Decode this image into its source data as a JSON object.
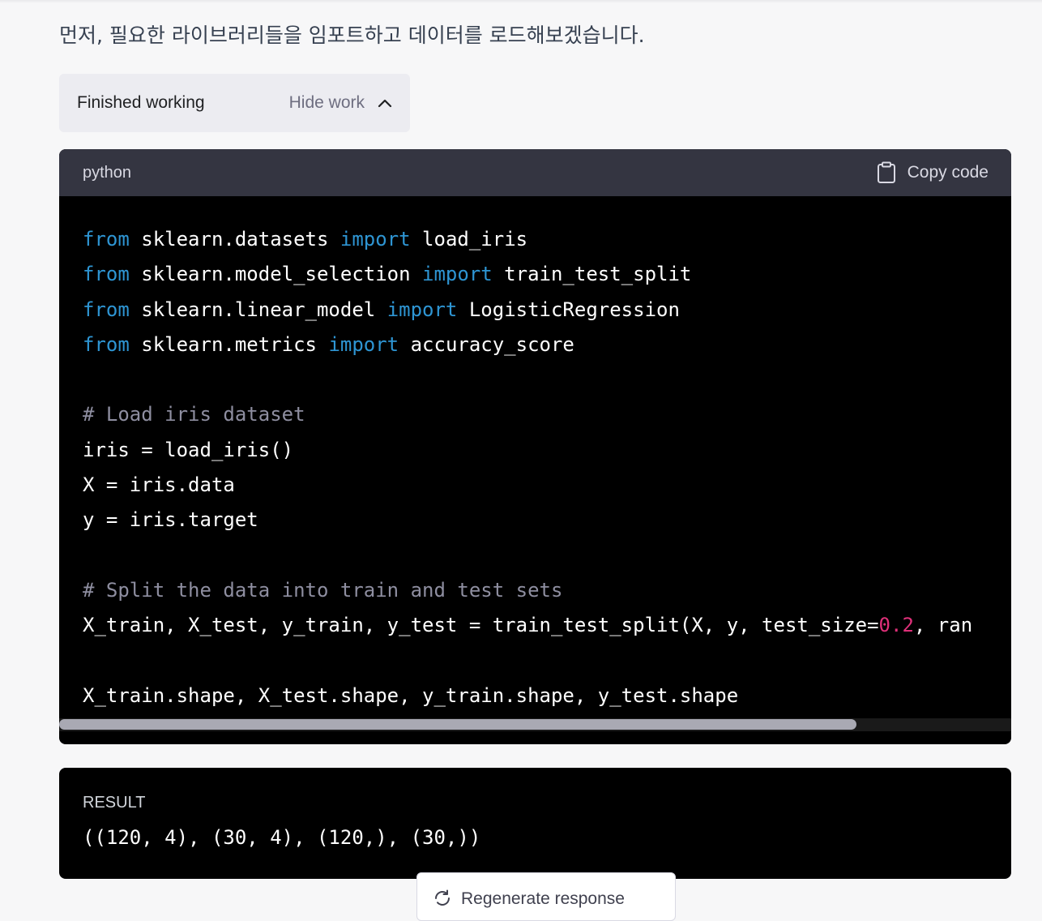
{
  "message": {
    "intro_text": "먼저, 필요한 라이브러리들을 임포트하고 데이터를 로드해보겠습니다."
  },
  "work_panel": {
    "status": "Finished working",
    "hide_label": "Hide work"
  },
  "code_block": {
    "language": "python",
    "copy_label": "Copy code",
    "lines": [
      "from sklearn.datasets import load_iris",
      "from sklearn.model_selection import train_test_split",
      "from sklearn.linear_model import LogisticRegression",
      "from sklearn.metrics import accuracy_score",
      "",
      "# Load iris dataset",
      "iris = load_iris()",
      "X = iris.data",
      "y = iris.target",
      "",
      "# Split the data into train and test sets",
      "X_train, X_test, y_train, y_test = train_test_split(X, y, test_size=0.2, ran",
      "",
      "X_train.shape, X_test.shape, y_train.shape, y_test.shape"
    ]
  },
  "result": {
    "label": "RESULT",
    "value": "((120, 4), (30, 4), (120,), (30,))"
  },
  "regenerate": {
    "label": "Regenerate response"
  },
  "colors": {
    "page_bg": "#f7f7f8",
    "keyword": "#2e95d3",
    "comment": "#8e8ea0",
    "number": "#df3079",
    "code_bg": "#000000",
    "code_header_bg": "#343541"
  }
}
